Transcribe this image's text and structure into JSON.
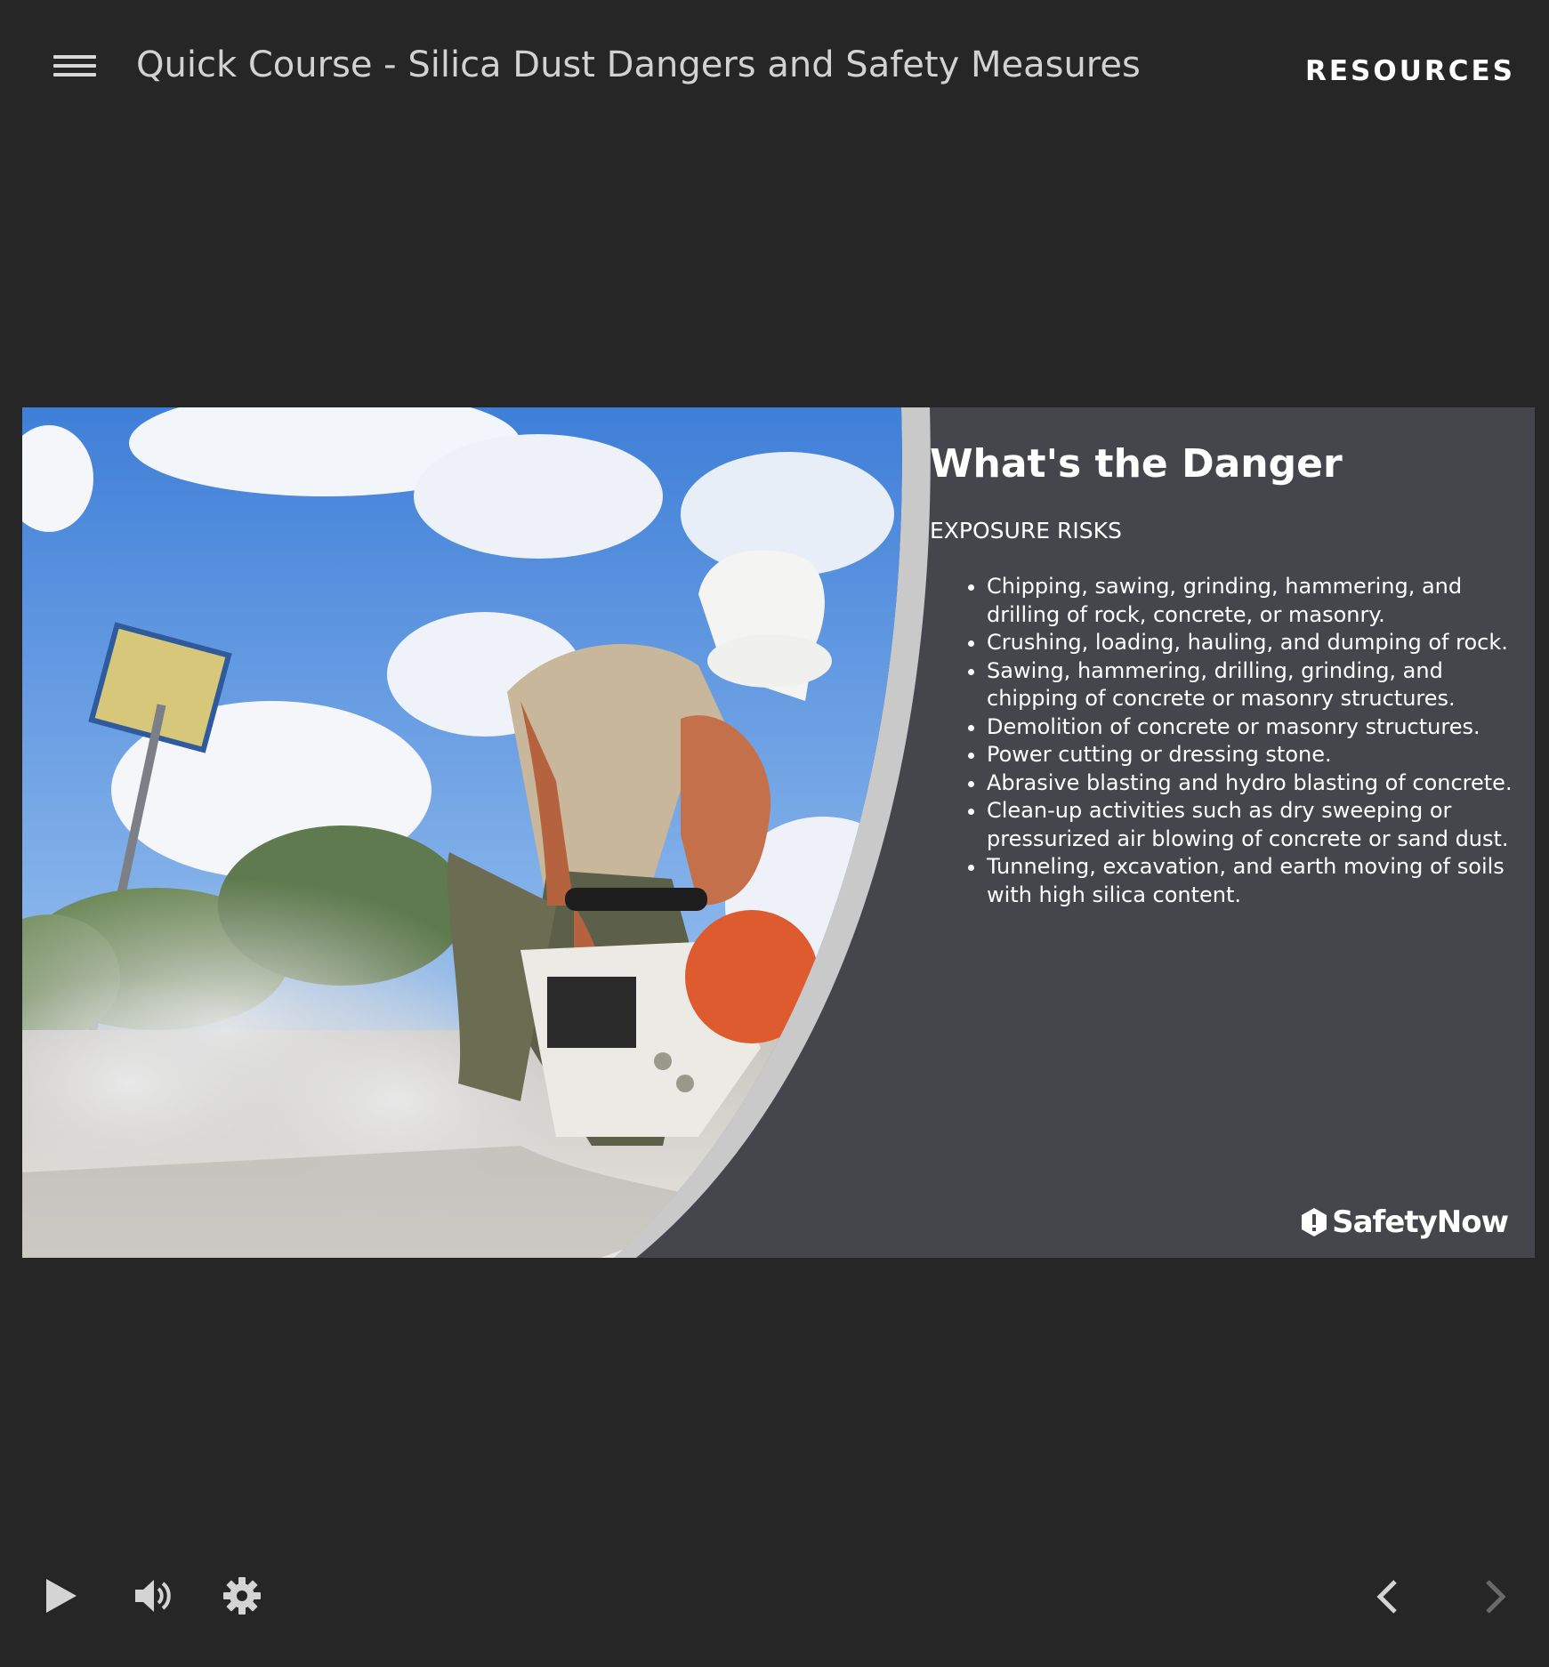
{
  "header": {
    "course_title": "Quick Course - Silica Dust Dangers and Safety Measures",
    "resources_label": "RESOURCES"
  },
  "slide": {
    "heading": "What's the Danger",
    "subheading": "EXPOSURE RISKS",
    "bullets": [
      "Chipping, sawing, grinding, hammering, and drilling of rock, concrete, or masonry.",
      "Crushing, loading, hauling, and dumping of rock.",
      "Sawing, hammering, drilling, grinding, and chipping of concrete or masonry structures.",
      "Demolition of concrete or masonry structures.",
      "Power cutting or dressing stone.",
      "Abrasive blasting and hydro blasting of concrete.",
      "Clean-up activities such as dry sweeping or pressurized air blowing of concrete or sand dust.",
      "Tunneling, excavation, and earth moving of soils with high silica content."
    ],
    "logo_text": "SafetyNow"
  },
  "controls": {
    "icons": [
      "play-icon",
      "volume-icon",
      "gear-icon",
      "chevron-left-icon",
      "chevron-right-icon"
    ]
  },
  "colors": {
    "page_bg": "#262626",
    "slide_panel": "#45464b",
    "curve": "#c9c9c9",
    "text": "#ffffff"
  }
}
